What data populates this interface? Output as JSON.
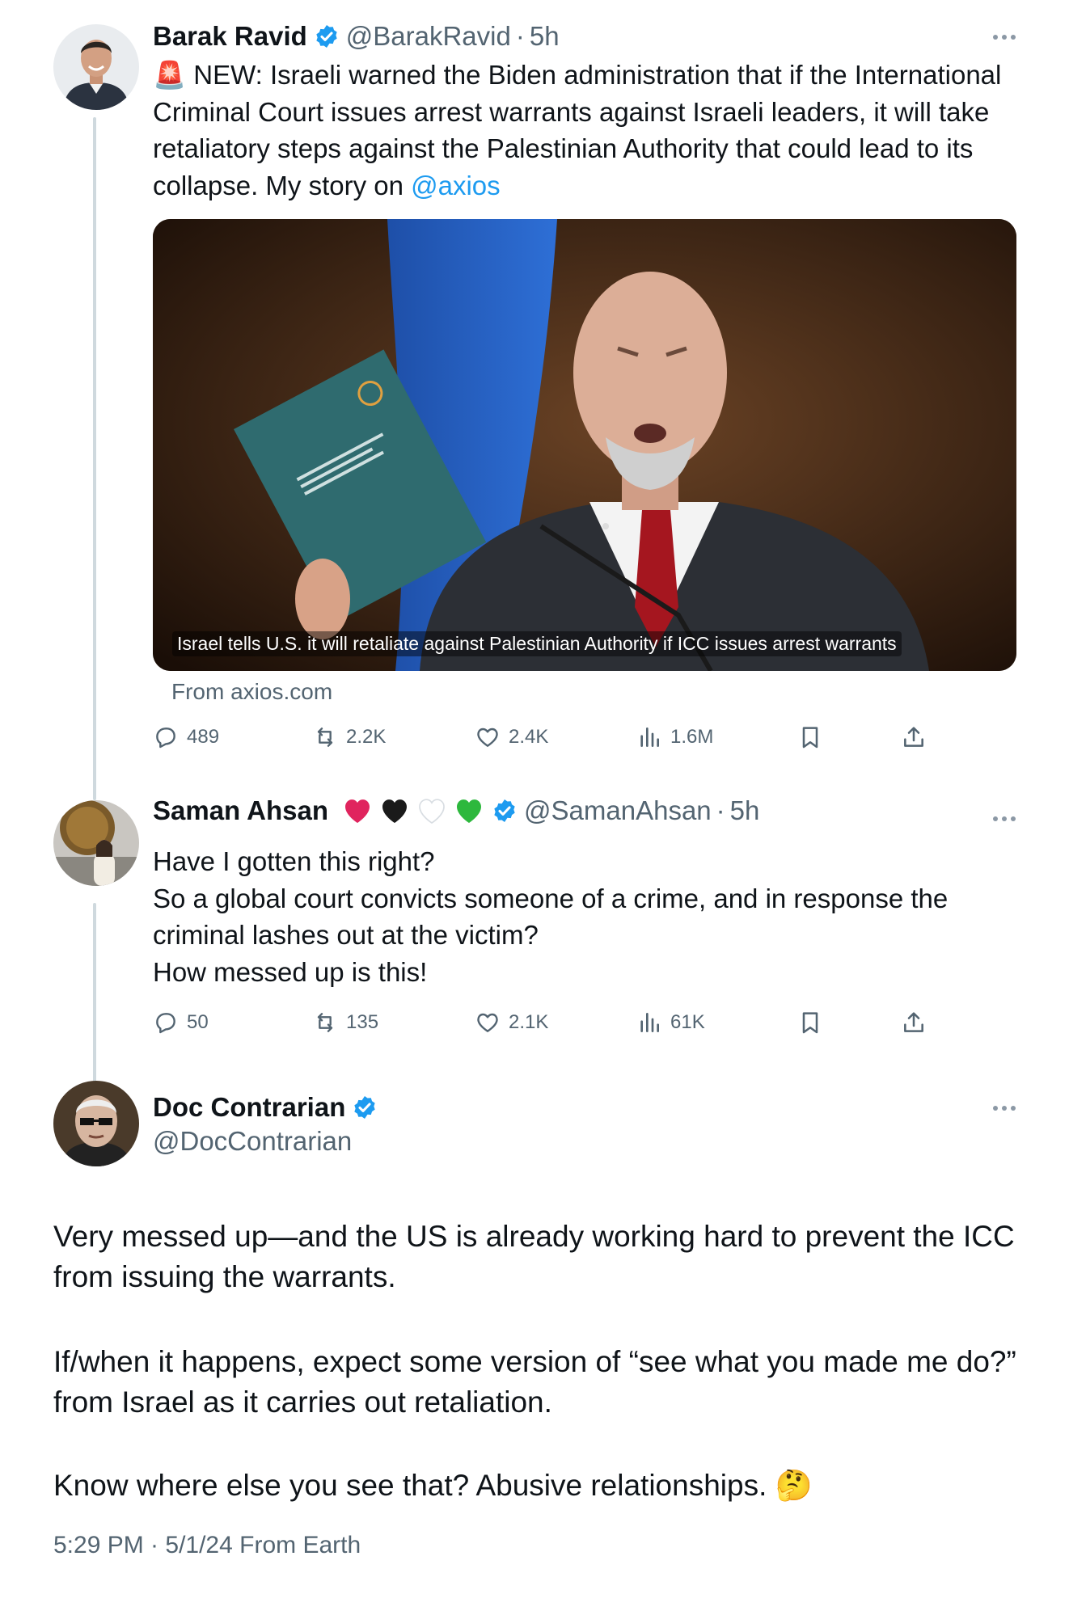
{
  "tweets": [
    {
      "name": "Barak Ravid",
      "handle": "@BarakRavid",
      "dot": "·",
      "time": "5h",
      "text_siren": "🚨",
      "text_main": " NEW: Israeli warned the Biden administration that if the International Criminal Court issues arrest warrants against Israeli leaders, it will take retaliatory steps against the Palestinian Authority that could lead to its collapse. My story on ",
      "text_link": "@axios",
      "card_caption": "Israel tells U.S. it will retaliate against Palestinian Authority if ICC issues arrest warrants",
      "card_from": "From axios.com",
      "stats": {
        "replies": "489",
        "reposts": "2.2K",
        "likes": "2.4K",
        "views": "1.6M"
      }
    },
    {
      "name": "Saman Ahsan",
      "handle": "@SamanAhsan",
      "dot": "·",
      "time": "5h",
      "heart_colors": [
        "#e0245e",
        "#1a1a1a",
        "#ffffff",
        "#2db83d"
      ],
      "lines": [
        "Have I gotten this right?",
        "So a global court convicts someone of a crime, and in response the criminal lashes out at the victim?",
        "How messed up is this!"
      ],
      "stats": {
        "replies": "50",
        "reposts": "135",
        "likes": "2.1K",
        "views": "61K"
      }
    },
    {
      "name": "Doc Contrarian",
      "handle": "@DocContrarian",
      "paragraphs": [
        "Very messed up—and the US is already working hard to prevent the ICC from issuing the warrants.",
        "If/when it happens, expect some version of “see what you made me do?” from Israel as it carries out retaliation.",
        "Know where else you see that? Abusive relationships. 🤔"
      ],
      "footer": "5:29 PM · 5/1/24 From Earth"
    }
  ],
  "colors": {
    "link": "#1d9bf0",
    "verified": "#1d9bf0",
    "muted": "#536471",
    "thread_line": "#cfd9de"
  }
}
